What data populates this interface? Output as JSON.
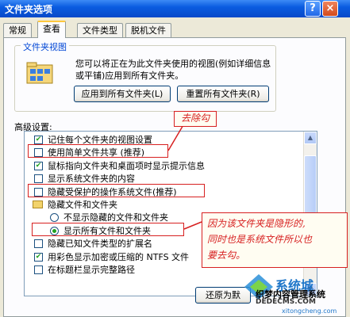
{
  "window": {
    "title": "文件夹选项",
    "help": "?",
    "close": "×"
  },
  "tabs": [
    {
      "label": "常规"
    },
    {
      "label": "查看"
    },
    {
      "label": "文件类型"
    },
    {
      "label": "脱机文件"
    }
  ],
  "folder_views": {
    "title": "文件夹视图",
    "description": "您可以将正在为此文件夹使用的视图(例如详细信息或平铺)应用到所有文件夹。",
    "apply_all": "应用到所有文件夹(L)",
    "reset_all": "重置所有文件夹(R)"
  },
  "advanced": {
    "label": "高级设置:",
    "items": [
      {
        "type": "checkbox",
        "checked": true,
        "label": "记住每个文件夹的视图设置"
      },
      {
        "type": "checkbox",
        "checked": false,
        "label": "使用简单文件共享 (推荐)"
      },
      {
        "type": "checkbox",
        "checked": true,
        "label": "鼠标指向文件夹和桌面项时显示提示信息"
      },
      {
        "type": "checkbox",
        "checked": false,
        "label": "显示系统文件夹的内容"
      },
      {
        "type": "checkbox",
        "checked": false,
        "label": "隐藏受保护的操作系统文件(推荐)"
      },
      {
        "type": "folder",
        "label": "隐藏文件和文件夹"
      },
      {
        "type": "radio",
        "checked": false,
        "label": "不显示隐藏的文件和文件夹"
      },
      {
        "type": "radio",
        "checked": true,
        "label": "显示所有文件和文件夹"
      },
      {
        "type": "checkbox",
        "checked": false,
        "label": "隐藏已知文件类型的扩展名"
      },
      {
        "type": "checkbox",
        "checked": true,
        "label": "用彩色显示加密或压缩的 NTFS 文件"
      },
      {
        "type": "checkbox",
        "checked": false,
        "label": "在标题栏显示完整路径"
      }
    ]
  },
  "restore_button": "还原为默",
  "annotations": {
    "remove_hook": "去除勾",
    "hidden_note_line1": "因为该文件夹是隐形的,",
    "hidden_note_line2": "同时也是系统文件所以也",
    "hidden_note_line3": "要去勾。"
  },
  "watermark": {
    "logo": "系统城",
    "text1": "织梦内容管理系统",
    "text2": "DEDECMS.COM",
    "text3": "xitongcheng.com"
  },
  "colors": {
    "title_bar": "#0a5ce0",
    "annotation": "#d72020",
    "checkmark": "#21a121"
  }
}
